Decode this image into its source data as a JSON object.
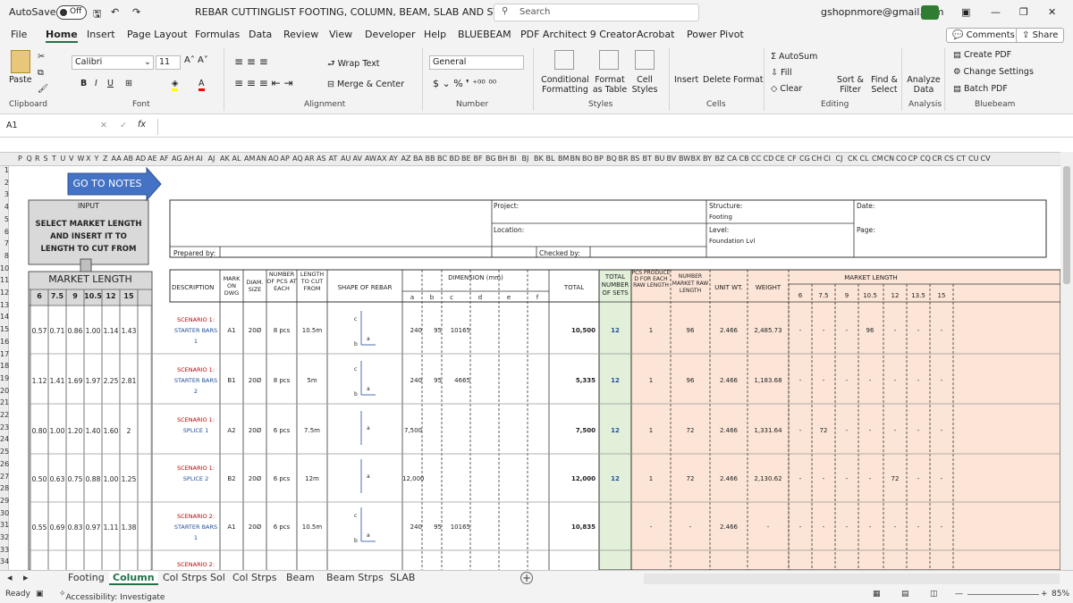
{
  "titlebar": {
    "autosave": "AutoSave",
    "autosave_state": "Off",
    "doc_title": "REBAR CUTTINGLIST FOOTING, COLUMN, BEAM, SLAB AND STIRRUPS",
    "search": "Search",
    "account": "gshopnmore@gmail.com"
  },
  "menu": {
    "items": [
      "File",
      "Home",
      "Insert",
      "Page Layout",
      "Formulas",
      "Data",
      "Review",
      "View",
      "Developer",
      "Help",
      "BLUEBEAM",
      "PDF Architect 9 Creator",
      "Acrobat",
      "Power Pivot"
    ],
    "comments": "Comments",
    "share": "Share"
  },
  "ribbon": {
    "paste": "Paste",
    "font_name": "Calibri",
    "font_size": "11",
    "wrap_text": "Wrap Text",
    "merge_center": "Merge & Center",
    "number_format": "General",
    "conditional": "Conditional Formatting",
    "format_table": "Format as Table",
    "cell_styles": "Cell Styles",
    "insert": "Insert",
    "delete": "Delete",
    "format": "Format",
    "autosum": "AutoSum",
    "fill": "Fill",
    "clear": "Clear",
    "sort_filter": "Sort & Filter",
    "find_select": "Find & Select",
    "analyze": "Analyze Data",
    "create_pdf": "Create PDF",
    "change_settings": "Change Settings",
    "batch_pdf": "Batch PDF",
    "groups": [
      "Clipboard",
      "Font",
      "Alignment",
      "Number",
      "Styles",
      "Cells",
      "Editing",
      "Analysis",
      "Bluebeam"
    ]
  },
  "formula": {
    "namebox": "A1",
    "fx": "fx"
  },
  "columns": [
    "P",
    "Q",
    "R",
    "S",
    "T",
    "U",
    "V",
    "W",
    "X",
    "Y",
    "Z",
    "AA",
    "AB",
    "AD",
    "AE",
    "AF",
    "AG",
    "AH",
    "AI",
    "AJ",
    "AK",
    "AL",
    "AM",
    "AN",
    "AO",
    "AP",
    "AQ",
    "AR",
    "AS",
    "AT",
    "AU",
    "AV",
    "AW",
    "AX",
    "AY",
    "AZ",
    "BA",
    "BB",
    "BC",
    "BD",
    "BE",
    "BF",
    "BG",
    "BH",
    "BI",
    "BJ",
    "BK",
    "BL",
    "BM",
    "BN",
    "BO",
    "BP",
    "BQ",
    "BR",
    "BS",
    "BT",
    "BU",
    "BV",
    "BW",
    "BX",
    "BY",
    "BZ",
    "CA",
    "CB",
    "CC",
    "CD",
    "CE",
    "CF",
    "CG",
    "CH",
    "CI",
    "CJ",
    "CK",
    "CL",
    "CM",
    "CN",
    "CO",
    "CP",
    "CQ",
    "CR",
    "CS",
    "CT",
    "CU",
    "CV"
  ],
  "rows": [
    "1",
    "2",
    "3",
    "4",
    "5",
    "6",
    "7",
    "8",
    "10",
    "11",
    "12",
    "13",
    "14",
    "15",
    "16",
    "17",
    "18",
    "19",
    "20",
    "21",
    "22",
    "23",
    "24",
    "25",
    "26",
    "27",
    "28",
    "29",
    "30",
    "31",
    "32",
    "33",
    "34"
  ],
  "sheet": {
    "goto_notes": "GO TO NOTES",
    "input_title": "INPUT",
    "input_text": "SELECT MARKET LENGTH AND INSERT IT TO LENGTH TO CUT FROM",
    "project": "Project:",
    "location": "Location:",
    "prepared_by": "Prepared by:",
    "checked_by": "Checked by:",
    "structure": "Structure:",
    "structure_val": "Footing",
    "level": "Level:",
    "level_val": "Foundation Lvl",
    "date": "Date:",
    "page": "Page:",
    "market_length": "MARKET LENGTH",
    "ml_cols": [
      "6",
      "7.5",
      "9",
      "10.5",
      "12",
      "15"
    ],
    "hdr_description": "DESCRIPTION",
    "hdr_mark": "MARK ON DWG",
    "hdr_diam": "DIAM. SIZE",
    "hdr_number": "NUMBER OF PCS AT EACH",
    "hdr_length": "LENGTH TO CUT FROM",
    "hdr_shape": "SHAPE OF REBAR",
    "hdr_dimension": "DIMENSION (mm)",
    "dim_cols": [
      "a",
      "b",
      "c",
      "d",
      "e",
      "f"
    ],
    "hdr_total": "TOTAL",
    "hdr_total_sets": "TOTAL NUMBER OF SETS",
    "hdr_pcs": "PCS PRODUCE D FOR EACH RAW LENGTH",
    "hdr_num_market": "NUMBER MARKET RAW LENGTH",
    "hdr_unit_wt": "UNIT WT.",
    "hdr_weight": "WEIGHT",
    "ml_right_title": "MARKET LENGTH",
    "ml_right_cols": [
      "6",
      "7.5",
      "9",
      "10.5",
      "12",
      "13.5",
      "15"
    ],
    "rows": [
      {
        "ml": [
          "0.57",
          "0.71",
          "0.86",
          "1.00",
          "1.14",
          "1.43"
        ],
        "desc1": "SCENARIO 1:",
        "desc2": "STARTER BARS",
        "desc3": "1",
        "mark": "A1",
        "diam": "20Ø",
        "num": "8 pcs",
        "len": "10.5m",
        "a": "240",
        "b": "95",
        "c": "10165",
        "total": "10,500",
        "sets": "12",
        "pcs": "1",
        "nmr": "96",
        "uw": "2.466",
        "wt": "2,485.73",
        "mlr": [
          "-",
          "-",
          "-",
          "96",
          "-",
          "-",
          "-"
        ]
      },
      {
        "ml": [
          "1.12",
          "1.41",
          "1.69",
          "1.97",
          "2.25",
          "2.81"
        ],
        "desc1": "SCENARIO 1:",
        "desc2": "STARTER BARS",
        "desc3": "2",
        "mark": "B1",
        "diam": "20Ø",
        "num": "8 pcs",
        "len": "5m",
        "a": "240",
        "b": "95",
        "c": "4665",
        "total": "5,335",
        "sets": "12",
        "pcs": "1",
        "nmr": "96",
        "uw": "2.466",
        "wt": "1,183.68",
        "mlr": [
          "-",
          "-",
          "-",
          "-",
          "-",
          "-",
          "-"
        ]
      },
      {
        "ml": [
          "0.80",
          "1.00",
          "1.20",
          "1.40",
          "1.60",
          "2"
        ],
        "desc1": "SCENARIO 1:",
        "desc2": "SPLICE 1",
        "desc3": "",
        "mark": "A2",
        "diam": "20Ø",
        "num": "6 pcs",
        "len": "7.5m",
        "a": "7,500",
        "b": "",
        "c": "",
        "total": "7,500",
        "sets": "12",
        "pcs": "1",
        "nmr": "72",
        "uw": "2.466",
        "wt": "1,331.64",
        "mlr": [
          "-",
          "72",
          "-",
          "-",
          "-",
          "-",
          "-"
        ]
      },
      {
        "ml": [
          "0.50",
          "0.63",
          "0.75",
          "0.88",
          "1.00",
          "1.25"
        ],
        "desc1": "SCENARIO 1:",
        "desc2": "SPLICE 2",
        "desc3": "",
        "mark": "B2",
        "diam": "20Ø",
        "num": "6 pcs",
        "len": "12m",
        "a": "12,000",
        "b": "",
        "c": "",
        "total": "12,000",
        "sets": "12",
        "pcs": "1",
        "nmr": "72",
        "uw": "2.466",
        "wt": "2,130.62",
        "mlr": [
          "-",
          "-",
          "-",
          "-",
          "72",
          "-",
          "-"
        ]
      },
      {
        "ml": [
          "0.55",
          "0.69",
          "0.83",
          "0.97",
          "1.11",
          "1.38"
        ],
        "desc1": "SCENARIO 2:",
        "desc2": "STARTER BARS",
        "desc3": "1",
        "mark": "A1",
        "diam": "20Ø",
        "num": "6 pcs",
        "len": "10.5m",
        "a": "240",
        "b": "95",
        "c": "10165",
        "total": "10,835",
        "sets": "",
        "pcs": "-",
        "nmr": "-",
        "uw": "2.466",
        "wt": "-",
        "mlr": [
          "-",
          "-",
          "-",
          "-",
          "-",
          "-",
          "-"
        ]
      }
    ],
    "last_desc": "SCENARIO 2:"
  },
  "tabs": {
    "items": [
      "Footing",
      "Column",
      "Col Strps Sol",
      "Col Strps",
      "Beam",
      "Beam Strps",
      "SLAB"
    ],
    "active": "Column"
  },
  "status": {
    "ready": "Ready",
    "accessibility": "Accessibility: Investigate",
    "zoom": "85%"
  }
}
